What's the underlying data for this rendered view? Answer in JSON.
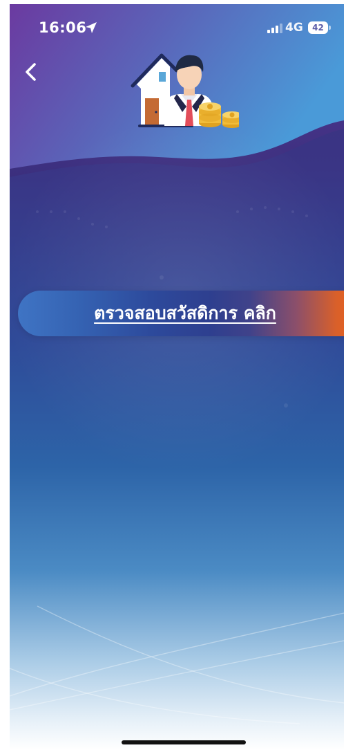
{
  "status_bar": {
    "time": "16:06",
    "location_icon": "location-arrow-icon",
    "signal_icon": "cellular-signal-icon",
    "network": "4G",
    "battery": "42",
    "battery_icon": "battery-icon"
  },
  "header": {
    "back_icon": "chevron-left-icon",
    "illustration": "house-person-coins-icon"
  },
  "main": {
    "cta_label": "ตรวจสอบสวัสดิการ คลิก"
  },
  "colors": {
    "background_top": "#3d2f7c",
    "background_bottom": "#ffffff",
    "header_wave": "#6a4aa8",
    "cta_start": "#3f74c4",
    "cta_end": "#e35f20"
  }
}
